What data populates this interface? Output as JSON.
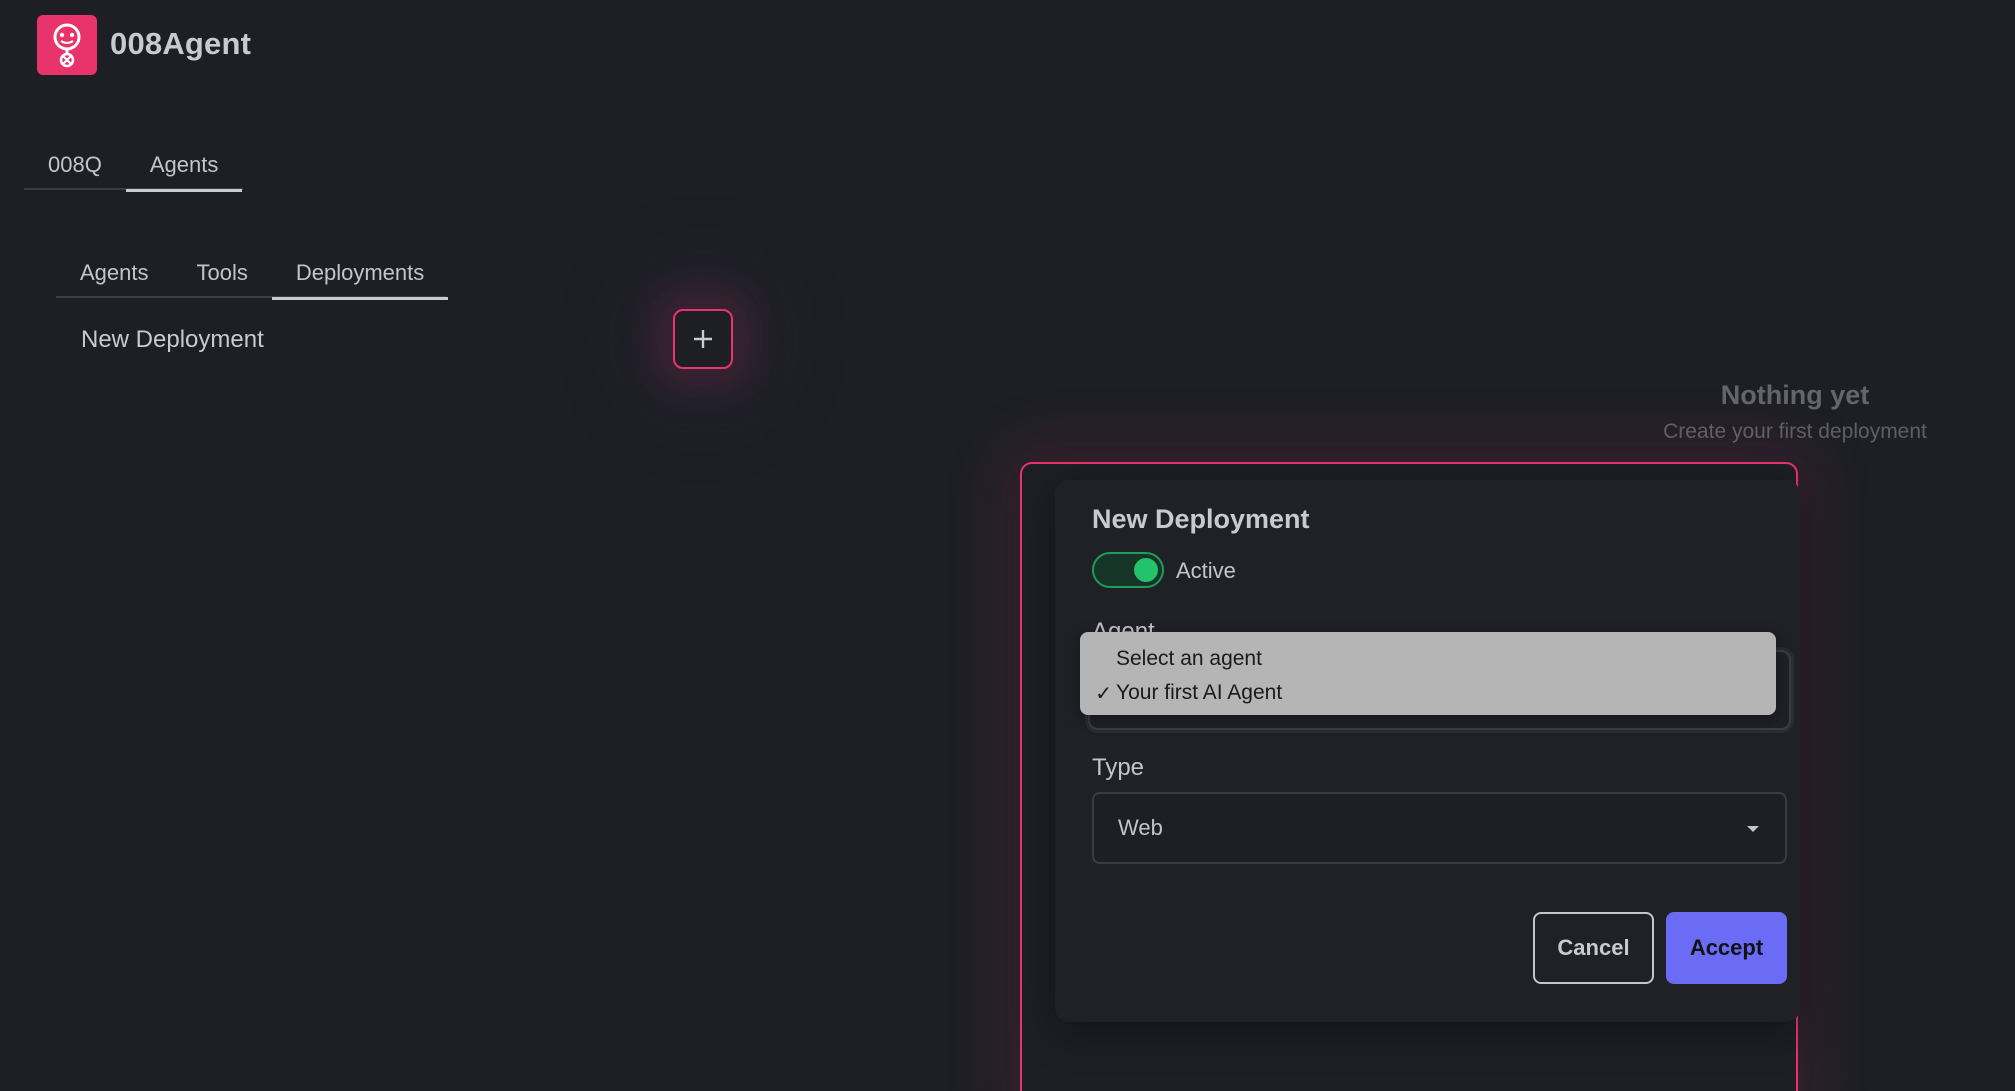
{
  "brand": {
    "name": "008Agent",
    "logo_icon": "robot-icon",
    "color": "#e8336b"
  },
  "top_tabs": [
    {
      "label": "008Q",
      "active": false
    },
    {
      "label": "Agents",
      "active": true
    }
  ],
  "sub_tabs": [
    {
      "label": "Agents",
      "active": false
    },
    {
      "label": "Tools",
      "active": false
    },
    {
      "label": "Deployments",
      "active": true
    }
  ],
  "list": {
    "title": "New Deployment",
    "add_icon": "plus-icon"
  },
  "empty_state": {
    "title": "Nothing yet",
    "subtitle": "Create your first deployment"
  },
  "modal": {
    "title": "New Deployment",
    "active_toggle": {
      "label": "Active",
      "on": true
    },
    "agent_field": {
      "label": "Agent",
      "options": [
        {
          "label": "Select an agent",
          "checked": ""
        },
        {
          "label": "Your first AI Agent",
          "checked": "✓"
        }
      ]
    },
    "type_field": {
      "label": "Type",
      "value": "Web"
    },
    "cancel_label": "Cancel",
    "accept_label": "Accept"
  },
  "colors": {
    "accent": "#e8336b",
    "primary_button": "#6a6cf6",
    "toggle_on": "#22c36a",
    "background": "#1d1f25"
  }
}
